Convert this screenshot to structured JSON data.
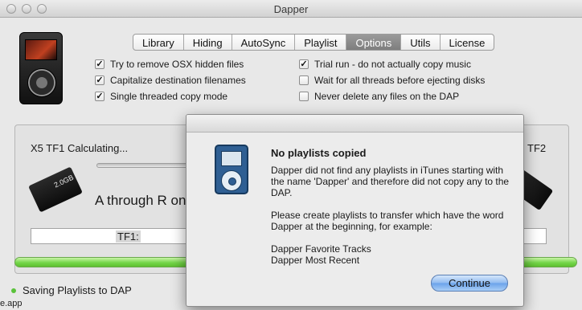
{
  "window": {
    "title": "Dapper"
  },
  "tabs": [
    {
      "label": "Library"
    },
    {
      "label": "Hiding"
    },
    {
      "label": "AutoSync"
    },
    {
      "label": "Playlist"
    },
    {
      "label": "Options"
    },
    {
      "label": "Utils"
    },
    {
      "label": "License"
    }
  ],
  "active_tab": "Options",
  "options_left": [
    {
      "label": "Try to remove OSX hidden files",
      "checked": true
    },
    {
      "label": "Capitalize destination filenames",
      "checked": true
    },
    {
      "label": "Single threaded copy mode",
      "checked": true
    }
  ],
  "options_right": [
    {
      "label": "Trial run - do not actually copy music",
      "checked": true
    },
    {
      "label": "Wait for all threads before ejecting disks",
      "checked": false
    },
    {
      "label": "Never delete any files on the DAP",
      "checked": false
    }
  ],
  "status": {
    "left_device": "X5 TF1 Calculating...",
    "right_device": "TF2",
    "card_label_left": "2.0GB",
    "current_letters": "A through R on",
    "field_label": "TF1:",
    "footer": "Saving Playlists to DAP",
    "footer_file": "e.app"
  },
  "dialog": {
    "title": "No playlists copied",
    "message1": "Dapper did not find any playlists in iTunes starting with the name 'Dapper' and therefore did not copy any to the DAP.",
    "message2": "Please create playlists to transfer which have the word Dapper at the beginning, for example:",
    "example1": "Dapper Favorite Tracks",
    "example2": "Dapper Most Recent",
    "button": "Continue"
  },
  "colors": {
    "accent": "#6aa2ea",
    "progress": "#74d64a",
    "ipod": "#2f5f93"
  },
  "icons": {
    "device": "dap-player-icon",
    "card": "sd-card-icon",
    "dialog": "ipod-icon"
  }
}
